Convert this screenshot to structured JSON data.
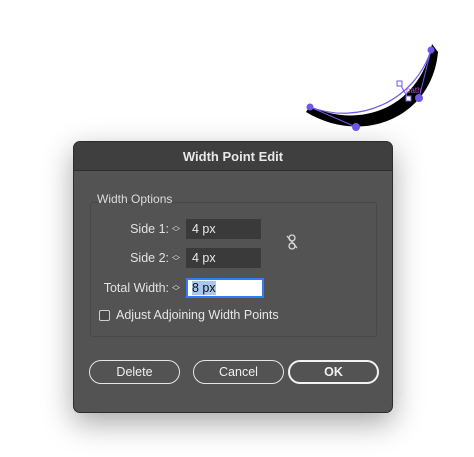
{
  "canvas": {
    "path_label": "path"
  },
  "dialog": {
    "title": "Width Point Edit",
    "group_label": "Width Options",
    "side1": {
      "label": "Side 1:",
      "value": "4 px"
    },
    "side2": {
      "label": "Side 2:",
      "value": "4 px"
    },
    "total": {
      "label": "Total Width:",
      "value": "8 px"
    },
    "adjoining": {
      "label": "Adjust Adjoining Width Points",
      "checked": false
    },
    "buttons": {
      "delete": "Delete",
      "cancel": "Cancel",
      "ok": "OK"
    }
  },
  "colors": {
    "stroke_shape": "#000000",
    "path_line": "#6e58e8",
    "anchor": "#6e58e8",
    "dialog_bg": "#535353",
    "focus": "#2f7ef6"
  },
  "icons": [
    "stepper-icon",
    "unlink-icon",
    "checkbox-icon"
  ]
}
